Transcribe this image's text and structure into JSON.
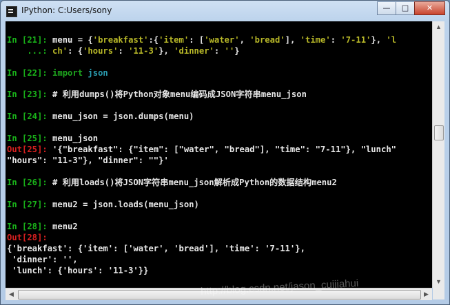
{
  "window": {
    "title": "IPython: C:Users/sony",
    "btn_min": "—",
    "btn_max": "□",
    "btn_close": "✕"
  },
  "colors": {
    "in_prompt": "#19b219",
    "out_prompt": "#d82020",
    "string": "#b8b828",
    "module": "#2a9cb0",
    "background": "#000000"
  },
  "console": {
    "l1": {
      "prompt": "In [21]: ",
      "a": "menu = {",
      "s1": "'breakfast'",
      "b": ":{",
      "s2": "'item'",
      "c": ": [",
      "s3": "'water'",
      "d": ", ",
      "s4": "'bread'",
      "e": "], ",
      "s5": "'time'",
      "f": ": ",
      "s6": "'7-11'",
      "g": "}, ",
      "s7": "'l"
    },
    "l2": {
      "prompt": "    ...: ",
      "s1": "ch'",
      "a": ": {",
      "s2": "'hours'",
      "b": ": ",
      "s3": "'11-3'",
      "c": "}, ",
      "s4": "'dinner'",
      "d": ": ",
      "s5": "''",
      "e": "}"
    },
    "l3": {
      "prompt": "In [22]: ",
      "kw": "import",
      "sp": " ",
      "mod": "json"
    },
    "l4": {
      "prompt": "In [23]: ",
      "text": "# 利用dumps()将Python对象menu编码成JSON字符串menu_json"
    },
    "l5": {
      "prompt": "In [24]: ",
      "text": "menu_json = json.dumps(menu)"
    },
    "l6": {
      "prompt": "In [25]: ",
      "text": "menu_json"
    },
    "l7": {
      "prompt": "Out[25]: ",
      "text": "'{\"breakfast\": {\"item\": [\"water\", \"bread\"], \"time\": \"7-11\"}, \"lunch\""
    },
    "l8": {
      "text": "\"hours\": \"11-3\"}, \"dinner\": \"\"}'"
    },
    "l9": {
      "prompt": "In [26]: ",
      "text": "# 利用loads()将JSON字符串menu_json解析成Python的数据结构menu2"
    },
    "l10": {
      "prompt": "In [27]: ",
      "text": "menu2 = json.loads(menu_json)"
    },
    "l11": {
      "prompt": "In [28]: ",
      "text": "menu2"
    },
    "l12": {
      "prompt": "Out[28]: "
    },
    "l13": {
      "text": "{'breakfast': {'item': ['water', 'bread'], 'time': '7-11'},"
    },
    "l14": {
      "text": " 'dinner': '',"
    },
    "l15": {
      "text": " 'lunch': {'hours': '11-3'}}"
    }
  },
  "watermark": "http://blog.csdn.net/jason_cuijiahui"
}
